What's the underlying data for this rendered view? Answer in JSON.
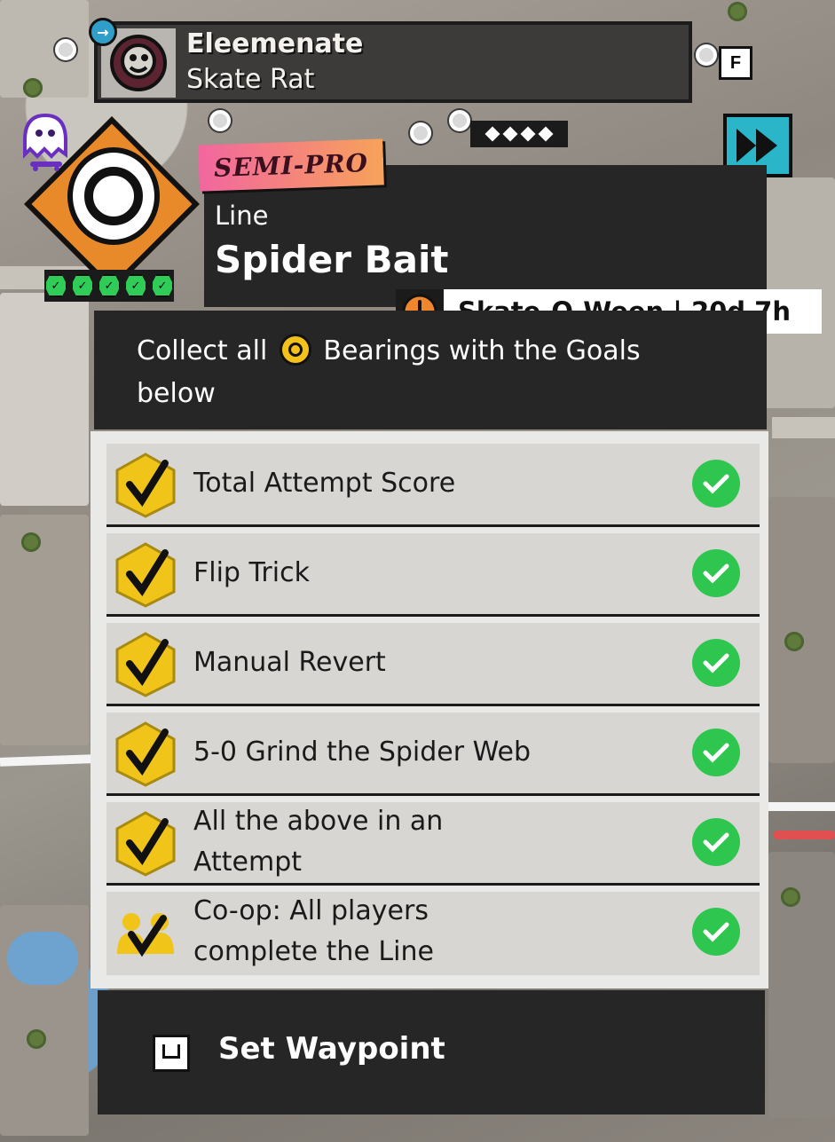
{
  "player": {
    "name": "Eleemenate",
    "rank": "Skate Rat",
    "keybind": "F"
  },
  "challenge": {
    "tier": "SEMI-PRO",
    "type": "Line",
    "name": "Spider Bait",
    "progress_pips": 5,
    "event": "Skate-O-Ween | 20d 7h",
    "objective_prefix": "Collect all",
    "objective_suffix": "Bearings with the Goals below"
  },
  "goals": [
    {
      "label": "Total Attempt Score",
      "completed": true,
      "icon": "check-badge-icon"
    },
    {
      "label": "Flip Trick",
      "completed": true,
      "icon": "check-badge-icon"
    },
    {
      "label": "Manual Revert",
      "completed": true,
      "icon": "check-badge-icon"
    },
    {
      "label": "5-0 Grind the Spider Web",
      "completed": true,
      "icon": "check-badge-icon"
    },
    {
      "label": "All the above in an Attempt",
      "completed": true,
      "icon": "check-badge-icon"
    },
    {
      "label": "Co-op: All players complete the Line",
      "completed": true,
      "icon": "coop-check-badge-icon"
    }
  ],
  "waypoint": {
    "label": "Set Waypoint"
  },
  "colors": {
    "panel_dark": "#262626",
    "goal_row": "#d7d6d3",
    "complete_green": "#2fc64f",
    "accent_orange": "#e98a2a",
    "tier_pink": "#f2669f",
    "cyan": "#2ab5c9"
  }
}
